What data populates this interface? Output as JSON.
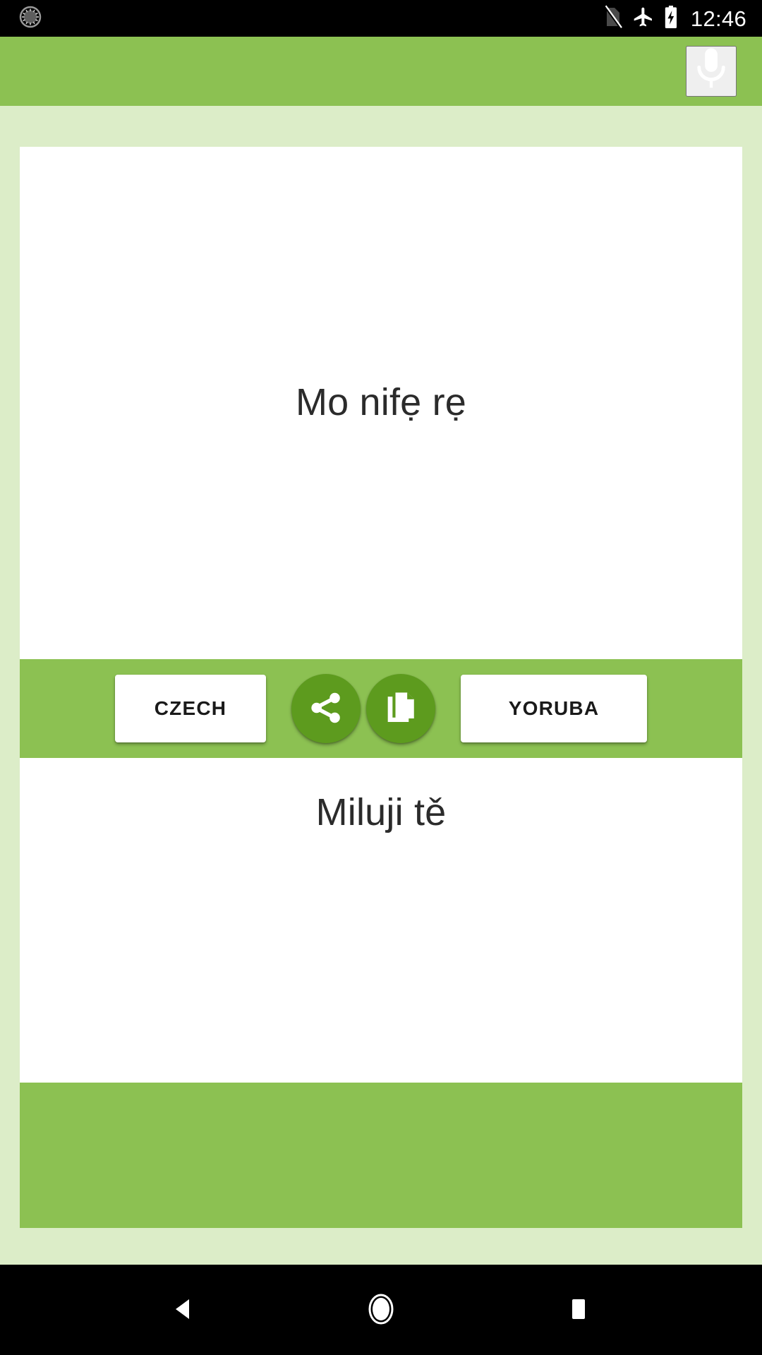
{
  "status_bar": {
    "notification_icon": "alarm-circle-icon",
    "no_sim_icon": "no-sim-icon",
    "airplane_icon": "airplane-mode-icon",
    "battery_icon": "battery-charging-icon",
    "clock": "12:46"
  },
  "app_bar": {
    "mic_icon": "microphone-icon",
    "accent_color": "#8CC152"
  },
  "translation": {
    "source_text": "Mo nifẹ rẹ",
    "target_text": "Miluji tě"
  },
  "controls": {
    "source_language_label": "CZECH",
    "target_language_label": "YORUBA",
    "share_icon": "share-icon",
    "copy_icon": "copy-icon",
    "round_button_color": "#5D9B1E"
  },
  "nav_bar": {
    "back_icon": "back-triangle-icon",
    "home_icon": "home-circle-icon",
    "recents_icon": "recents-square-icon"
  },
  "colors": {
    "accent": "#8CC152",
    "page_background": "#DCEDC8",
    "card_background": "#FFFFFF",
    "text": "#2B2B2B"
  }
}
